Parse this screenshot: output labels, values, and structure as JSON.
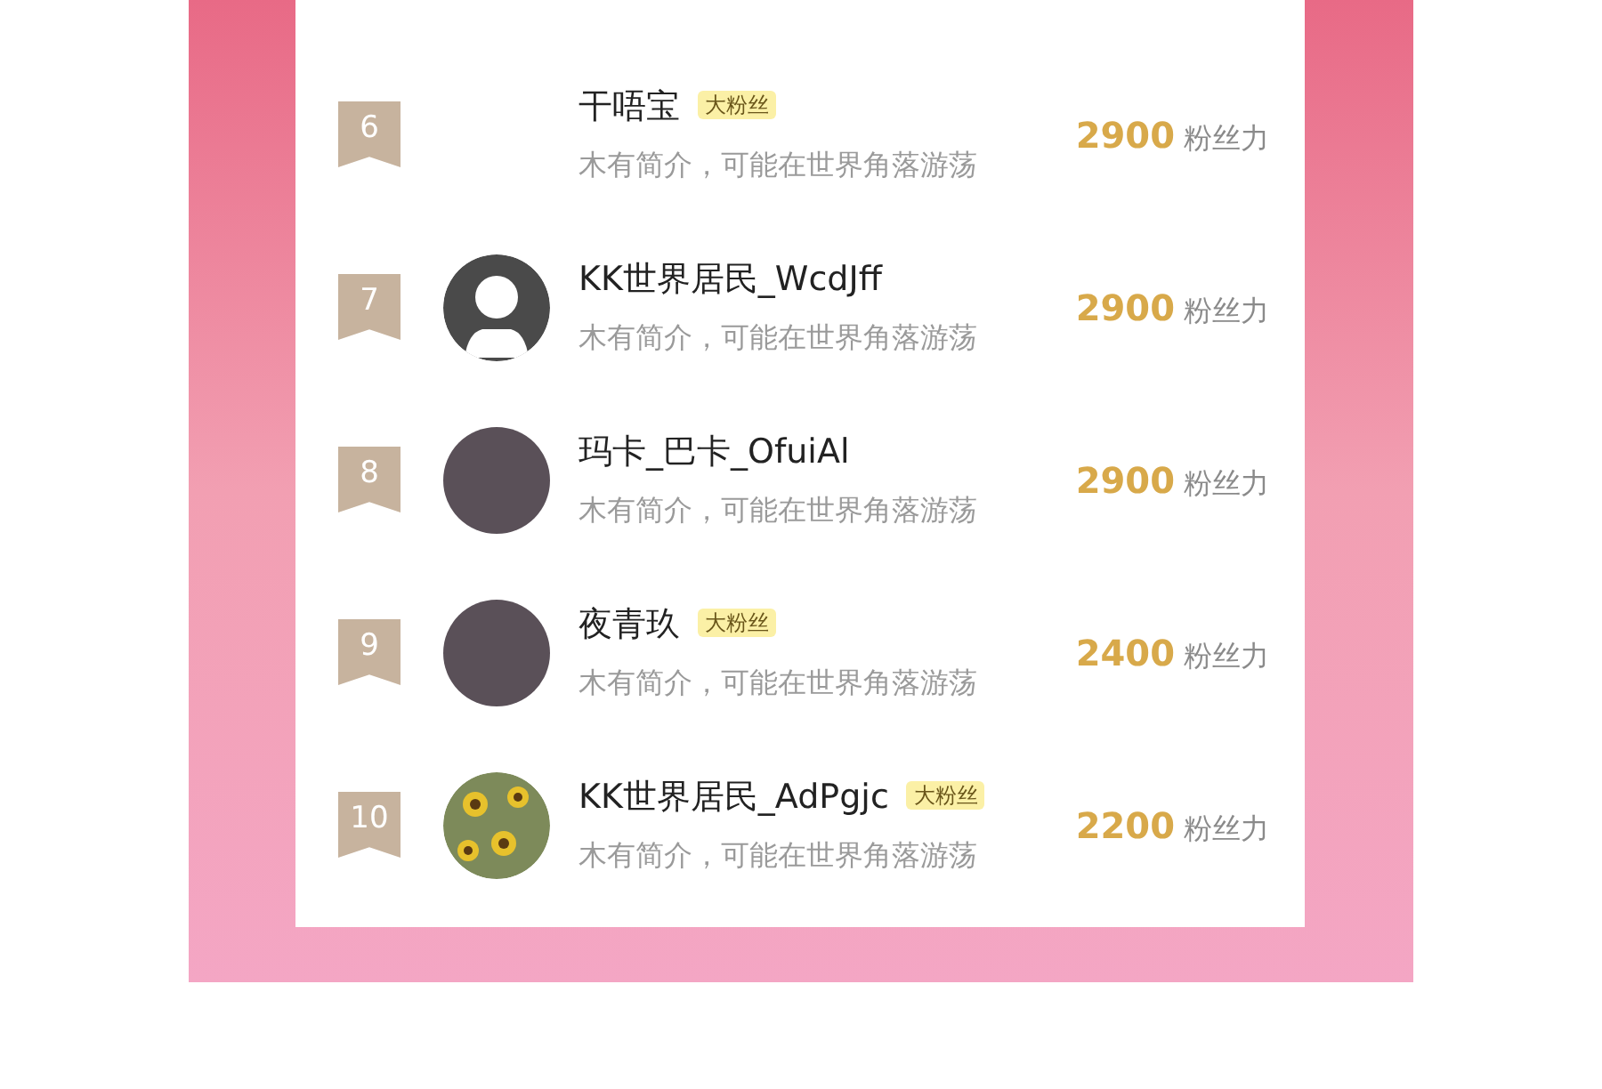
{
  "ranking": [
    {
      "rank": "6",
      "kind": "blank",
      "name": "干唔宝",
      "badge": "大粉丝",
      "bio": "木有简介，可能在世界角落游荡",
      "score": "2900",
      "unit": "粉丝力"
    },
    {
      "rank": "7",
      "kind": "default",
      "name": "KK世界居民_WcdJff",
      "bio": "木有简介，可能在世界角落游荡",
      "score": "2900",
      "unit": "粉丝力"
    },
    {
      "rank": "8",
      "kind": "photo",
      "name": "玛卡_巴卡_OfuiAl",
      "bio": "木有简介，可能在世界角落游荡",
      "score": "2900",
      "unit": "粉丝力"
    },
    {
      "rank": "9",
      "kind": "photo",
      "name": "夜青玖",
      "badge": "大粉丝",
      "bio": "木有简介，可能在世界角落游荡",
      "score": "2400",
      "unit": "粉丝力"
    },
    {
      "rank": "10",
      "kind": "flowers",
      "name": "KK世界居民_AdPgjc",
      "badge": "大粉丝",
      "bio": "木有简介，可能在世界角落游荡",
      "score": "2200",
      "unit": "粉丝力"
    }
  ]
}
